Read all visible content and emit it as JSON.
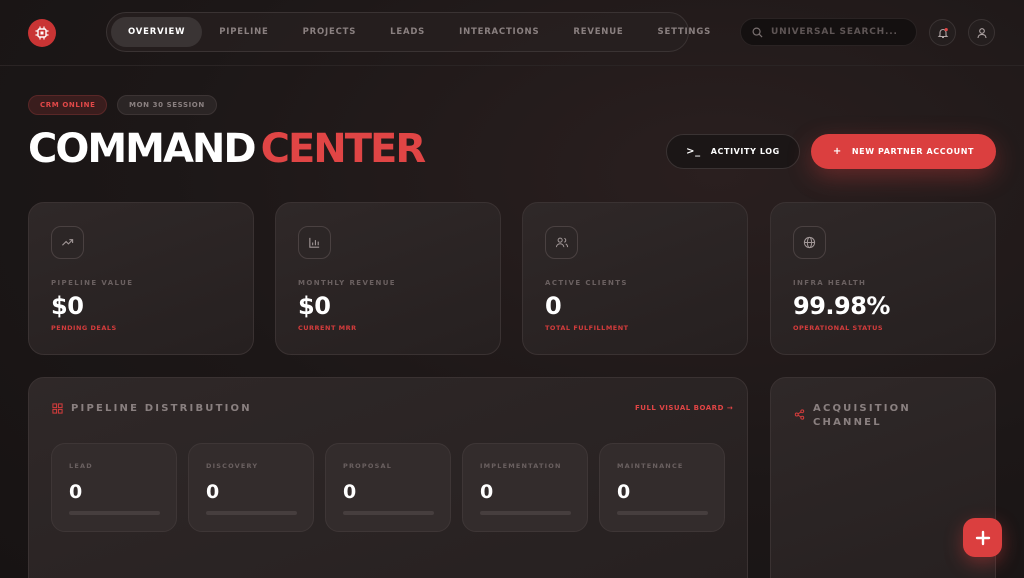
{
  "nav": {
    "items": [
      {
        "label": "OVERVIEW",
        "active": true
      },
      {
        "label": "PIPELINE"
      },
      {
        "label": "PROJECTS"
      },
      {
        "label": "LEADS"
      },
      {
        "label": "INTERACTIONS"
      },
      {
        "label": "REVENUE"
      },
      {
        "label": "SETTINGS"
      }
    ]
  },
  "search": {
    "placeholder": "UNIVERSAL SEARCH..."
  },
  "status": {
    "online": "CRM ONLINE",
    "session": "MON 30 SESSION"
  },
  "title": {
    "part1": "COMMAND",
    "part2": "CENTER"
  },
  "actions": {
    "activity_log": "ACTIVITY LOG",
    "new_partner": "NEW PARTNER ACCOUNT"
  },
  "stats": [
    {
      "label": "PIPELINE VALUE",
      "value": "$0",
      "sub": "PENDING DEALS",
      "icon": "trending-up-icon"
    },
    {
      "label": "MONTHLY REVENUE",
      "value": "$0",
      "sub": "CURRENT MRR",
      "icon": "bar-chart-icon"
    },
    {
      "label": "ACTIVE CLIENTS",
      "value": "0",
      "sub": "TOTAL FULFILLMENT",
      "icon": "users-icon"
    },
    {
      "label": "INFRA HEALTH",
      "value": "99.98%",
      "sub": "OPERATIONAL STATUS",
      "icon": "globe-icon"
    }
  ],
  "pipeline": {
    "title": "PIPELINE DISTRIBUTION",
    "link": "FULL VISUAL BOARD →",
    "stages": [
      {
        "label": "LEAD",
        "value": "0",
        "progress": 0
      },
      {
        "label": "DISCOVERY",
        "value": "0",
        "progress": 0
      },
      {
        "label": "PROPOSAL",
        "value": "0",
        "progress": 0
      },
      {
        "label": "IMPLEMENTATION",
        "value": "0",
        "progress": 0
      },
      {
        "label": "MAINTENANCE",
        "value": "0",
        "progress": 0
      }
    ]
  },
  "acquisition": {
    "title_line1": "ACQUISITION",
    "title_line2": "CHANNEL"
  },
  "colors": {
    "accent": "#db3f3f",
    "background": "#1c1717",
    "card": "#2a2323"
  }
}
